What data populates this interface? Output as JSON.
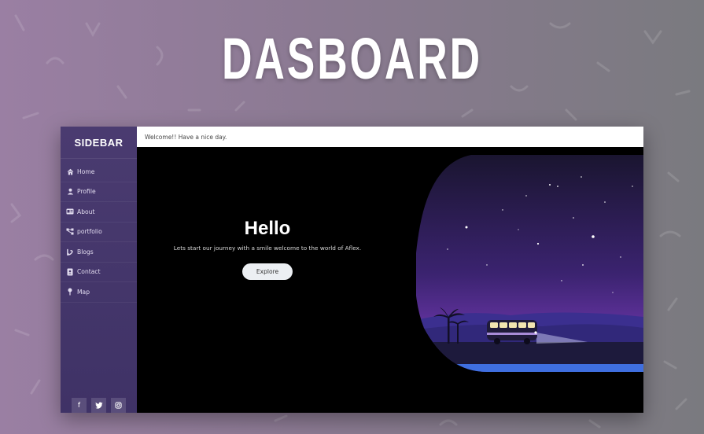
{
  "banner": {
    "title": "DASBOARD"
  },
  "sidebar": {
    "title": "SIDEBAR",
    "items": [
      {
        "label": "Home",
        "icon": "home-icon"
      },
      {
        "label": "Profile",
        "icon": "user-icon"
      },
      {
        "label": "About",
        "icon": "id-card-icon"
      },
      {
        "label": "portfolio",
        "icon": "share-nodes-icon"
      },
      {
        "label": "Blogs",
        "icon": "blog-icon"
      },
      {
        "label": "Contact",
        "icon": "contact-book-icon"
      },
      {
        "label": "Map",
        "icon": "map-pin-icon"
      }
    ],
    "social": [
      {
        "glyph": "f",
        "icon": "facebook-icon"
      },
      {
        "glyph": "t",
        "icon": "twitter-icon"
      },
      {
        "glyph": "◎",
        "icon": "instagram-icon"
      }
    ]
  },
  "topbar": {
    "message": "Welcome!! Have a nice day."
  },
  "hero": {
    "title": "Hello",
    "subtitle": "Lets start our journey with a smile welcome to the world of Aflex.",
    "button_label": "Explore"
  },
  "colors": {
    "sidebar": "#453769",
    "sky_top": "#1a1530",
    "sky_bottom": "#5b2d8c",
    "water": "#3f6fe0"
  }
}
